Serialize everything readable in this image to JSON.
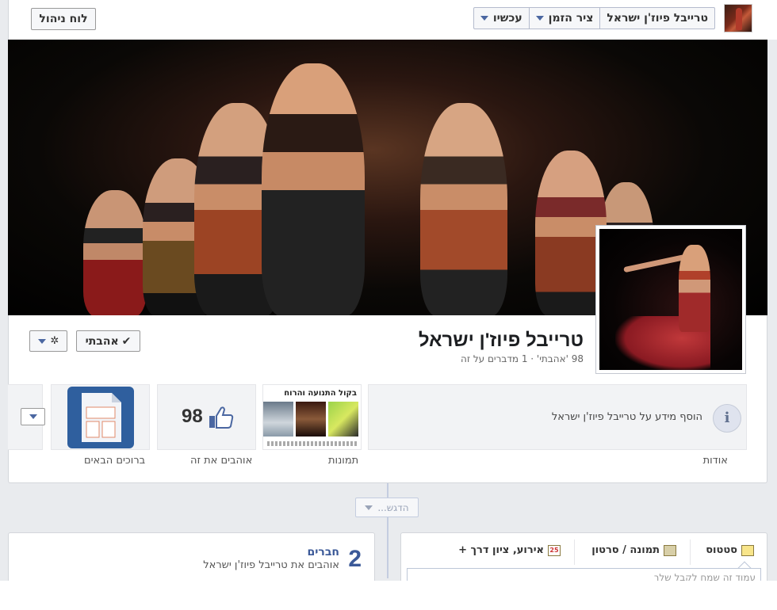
{
  "topbar": {
    "page_name": "טרייבל פיוז'ן ישראל",
    "timeline_label": "ציר הזמן",
    "now_label": "עכשיו",
    "admin_label": "לוח ניהול"
  },
  "page": {
    "name": "טרייבל פיוז'ן ישראל",
    "stats": "98 'אהבתי' · 1 מדברים על זה",
    "like_button": "אהבתי",
    "like_check": "✔",
    "gear_glyph": "✲"
  },
  "about": {
    "icon_glyph": "i",
    "text": "הוסף מידע על טרייבל פיוז'ן ישראל",
    "label": "אודות"
  },
  "tiles": {
    "photos_label": "תמונות",
    "photos_caption": "בקול התנועה והרוח",
    "likes_count": "98",
    "likes_label": "אוהבים את זה",
    "apps_label": "ברוכים הבאים"
  },
  "timeline": {
    "highlight_label": "הדגש..."
  },
  "composer": {
    "status_label": "סטטוס",
    "photo_label": "תמונה / סרטון",
    "event_label": "אירוע, ציון דרך +",
    "event_day": "25",
    "input_placeholder": "עמוד זה שמח לקבל שלך"
  },
  "friends": {
    "count": "2",
    "title": "חברים",
    "subtitle": "אוהבים את טרייבל פיוז'ן ישראל"
  },
  "icons": {
    "like": "check-icon",
    "settings": "gear-icon",
    "info": "info-icon",
    "thumb": "thumbs-up-icon",
    "apps": "document-icon"
  },
  "colors": {
    "brand": "#3b5998",
    "background": "#e9ebee",
    "border": "#d3d6db"
  }
}
